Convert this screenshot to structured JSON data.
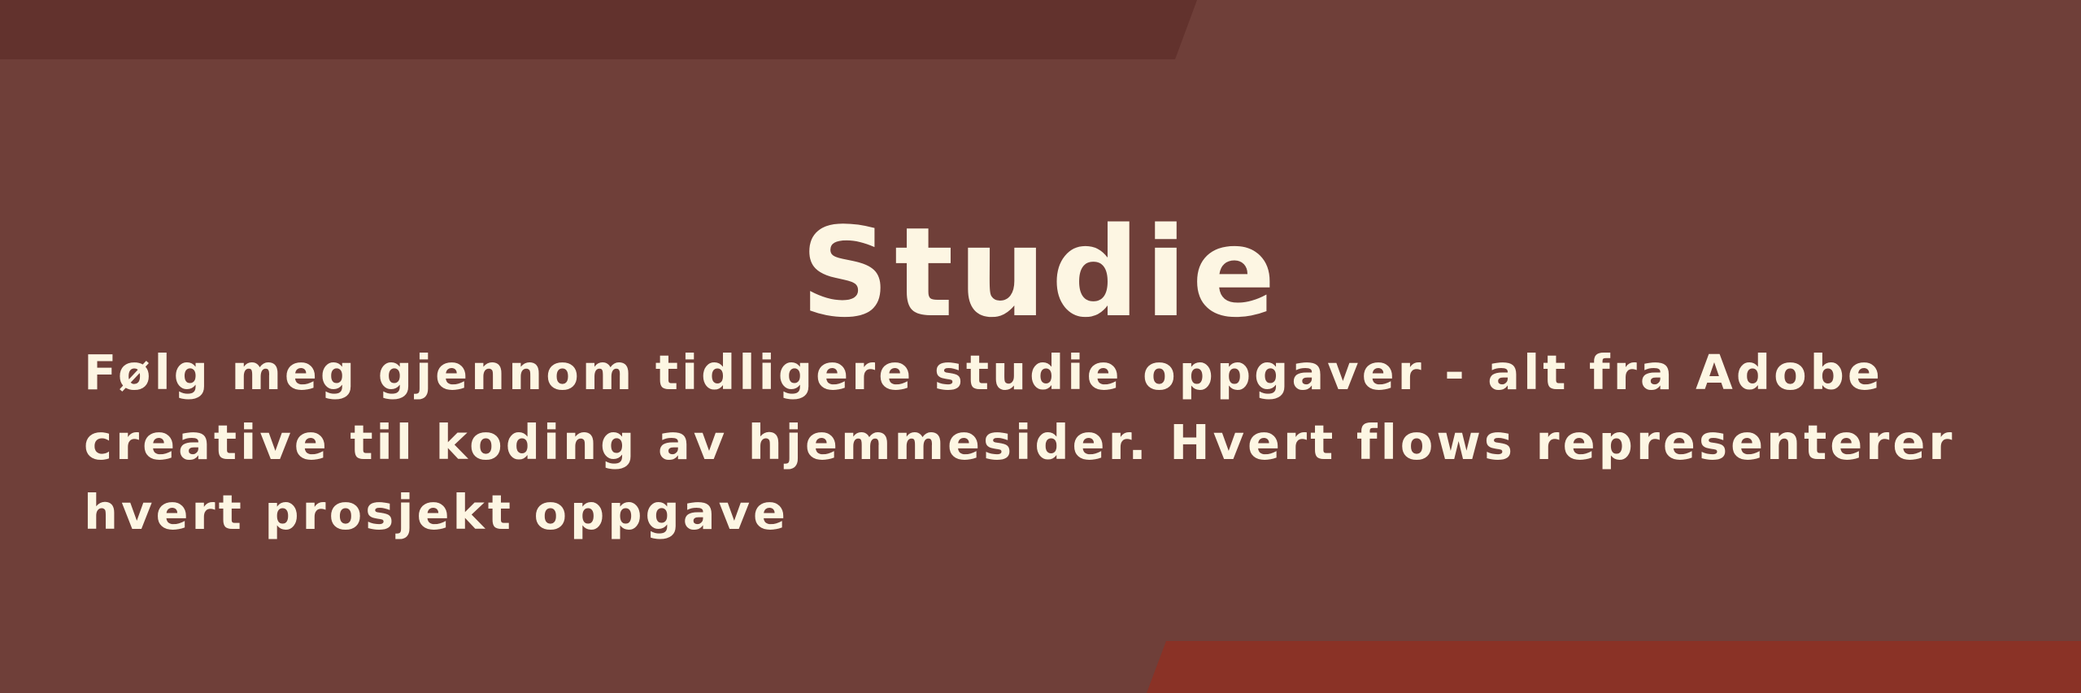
{
  "header": {
    "title": "Studie"
  },
  "description": {
    "line1": "Følg meg gjennom tidligere studie oppgaver - alt fra Adobe",
    "line2": "creative til koding av hjemmesider. Hvert flows representerer",
    "line3": "hvert prosjekt oppgave"
  },
  "colors": {
    "background": "#6f3f39",
    "top_band": "#62322d",
    "bottom_band": "#8a3226",
    "text": "#fdf6e3"
  }
}
